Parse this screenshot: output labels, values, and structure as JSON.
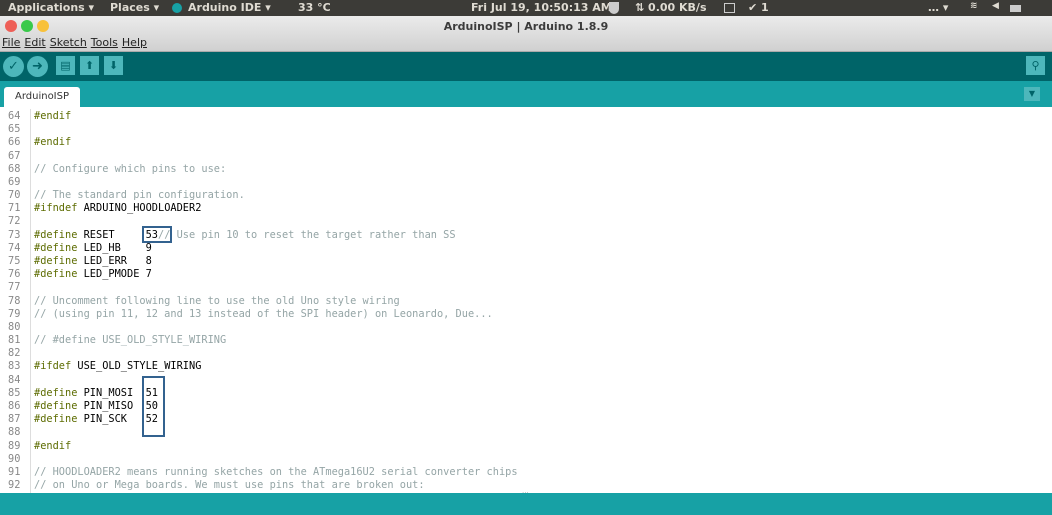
{
  "topbar": {
    "applications": "Applications ▾",
    "places": "Places ▾",
    "app": "Arduino IDE ▾",
    "weather": "33 °C",
    "clock": "Fri Jul 19, 10:50:13 AM",
    "net": "⇅ 0.00 KB/s",
    "tasks": "✔ 1",
    "more": "… ▾"
  },
  "window": {
    "title": "ArduinoISP | Arduino 1.8.9"
  },
  "menu": [
    "File",
    "Edit",
    "Sketch",
    "Tools",
    "Help"
  ],
  "toolbar": {
    "verify": "✓",
    "upload": "➜",
    "new": "▤",
    "open": "⬆",
    "save": "⬇",
    "serial": "⚲"
  },
  "tab": {
    "label": "ArduinoISP",
    "menu": "▼"
  },
  "code": [
    {
      "n": "64",
      "t": "#endif"
    },
    {
      "n": "65",
      "t": ""
    },
    {
      "n": "66",
      "t": "#endif"
    },
    {
      "n": "67",
      "t": ""
    },
    {
      "n": "68",
      "t": "// Configure which pins to use:"
    },
    {
      "n": "69",
      "t": ""
    },
    {
      "n": "70",
      "t": "// The standard pin configuration."
    },
    {
      "n": "71",
      "t": "#ifndef ARDUINO_HOODLOADER2"
    },
    {
      "n": "72",
      "t": ""
    },
    {
      "n": "73",
      "t": "#define RESET     53// Use pin 10 to reset the target rather than SS"
    },
    {
      "n": "74",
      "t": "#define LED_HB    9"
    },
    {
      "n": "75",
      "t": "#define LED_ERR   8"
    },
    {
      "n": "76",
      "t": "#define LED_PMODE 7"
    },
    {
      "n": "77",
      "t": ""
    },
    {
      "n": "78",
      "t": "// Uncomment following line to use the old Uno style wiring"
    },
    {
      "n": "79",
      "t": "// (using pin 11, 12 and 13 instead of the SPI header) on Leonardo, Due..."
    },
    {
      "n": "80",
      "t": ""
    },
    {
      "n": "81",
      "t": "// #define USE_OLD_STYLE_WIRING"
    },
    {
      "n": "82",
      "t": ""
    },
    {
      "n": "83",
      "t": "#ifdef USE_OLD_STYLE_WIRING"
    },
    {
      "n": "84",
      "t": ""
    },
    {
      "n": "85",
      "t": "#define PIN_MOSI  51"
    },
    {
      "n": "86",
      "t": "#define PIN_MISO  50"
    },
    {
      "n": "87",
      "t": "#define PIN_SCK   52"
    },
    {
      "n": "88",
      "t": ""
    },
    {
      "n": "89",
      "t": "#endif"
    },
    {
      "n": "90",
      "t": ""
    },
    {
      "n": "91",
      "t": "// HOODLOADER2 means running sketches on the ATmega16U2 serial converter chips"
    },
    {
      "n": "92",
      "t": "// on Uno or Mega boards. We must use pins that are broken out:"
    }
  ],
  "grip": "..."
}
